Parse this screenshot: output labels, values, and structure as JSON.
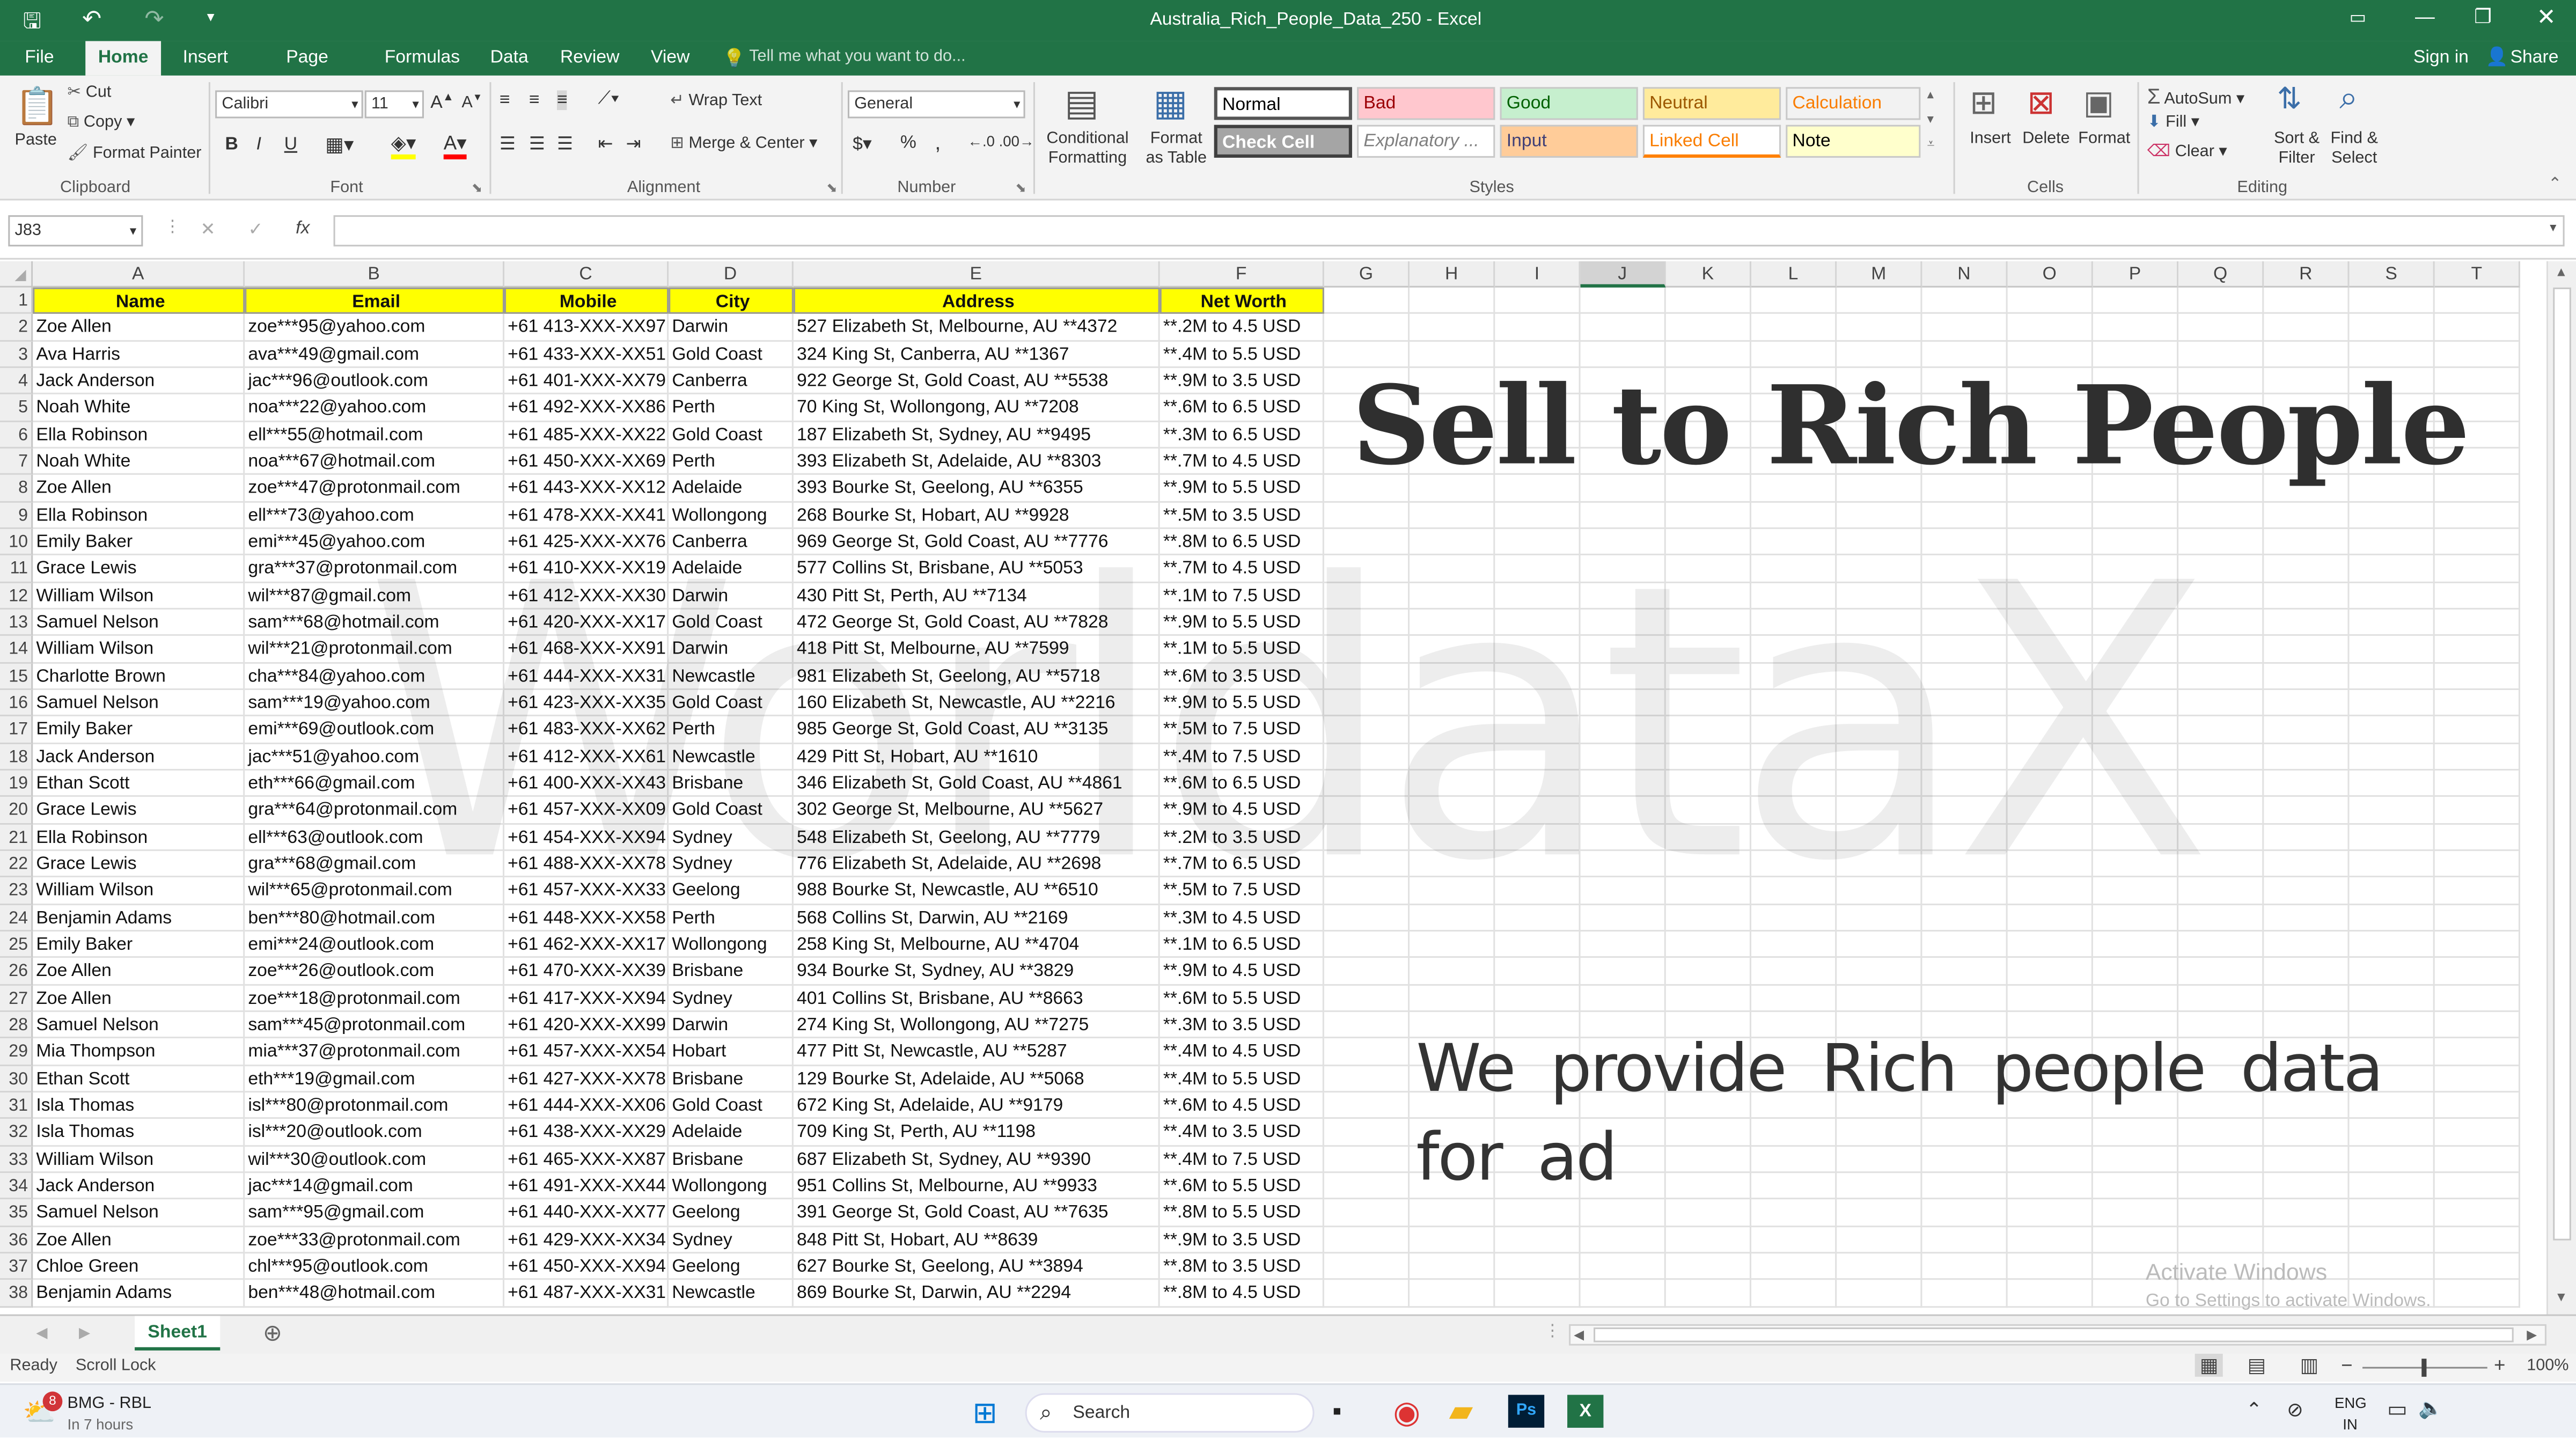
{
  "window": {
    "title": "Australia_Rich_People_Data_250 - Excel",
    "signin": "Sign in",
    "share": "Share",
    "tell_me": "Tell me what you want to do..."
  },
  "ribbon_tabs": [
    "File",
    "Home",
    "Insert",
    "Page Layout",
    "Formulas",
    "Data",
    "Review",
    "View"
  ],
  "ribbon": {
    "clipboard": {
      "paste": "Paste",
      "cut": "Cut",
      "copy": "Copy",
      "format_painter": "Format Painter",
      "label": "Clipboard"
    },
    "font": {
      "name": "Calibri",
      "size": "11",
      "label": "Font",
      "bold": "B",
      "italic": "I",
      "underline": "U"
    },
    "alignment": {
      "wrap": "Wrap Text",
      "merge": "Merge & Center",
      "label": "Alignment"
    },
    "number": {
      "format": "General",
      "percent": "%",
      "comma": ",",
      "label": "Number"
    },
    "styles": {
      "conditional": "Conditional Formatting",
      "format_table": "Format as Table",
      "label": "Styles",
      "items": [
        {
          "name": "Normal",
          "bg": "#ffffff",
          "fg": "#000000"
        },
        {
          "name": "Bad",
          "bg": "#ffc7ce",
          "fg": "#9c0006"
        },
        {
          "name": "Good",
          "bg": "#c6efce",
          "fg": "#006100"
        },
        {
          "name": "Neutral",
          "bg": "#ffeb9c",
          "fg": "#9c5700"
        },
        {
          "name": "Calculation",
          "bg": "#f2f2f2",
          "fg": "#fa7d00"
        },
        {
          "name": "Check Cell",
          "bg": "#a5a5a5",
          "fg": "#ffffff"
        },
        {
          "name": "Explanatory ...",
          "bg": "#ffffff",
          "fg": "#7f7f7f"
        },
        {
          "name": "Input",
          "bg": "#ffcc99",
          "fg": "#3f3f76"
        },
        {
          "name": "Linked Cell",
          "bg": "#ffffff",
          "fg": "#fa7d00"
        },
        {
          "name": "Note",
          "bg": "#ffffcc",
          "fg": "#000000"
        }
      ]
    },
    "cells": {
      "insert": "Insert",
      "delete": "Delete",
      "format": "Format",
      "label": "Cells"
    },
    "editing": {
      "autosum": "AutoSum",
      "fill": "Fill",
      "clear": "Clear",
      "sort": "Sort & Filter",
      "find": "Find & Select",
      "label": "Editing"
    }
  },
  "formula_bar": {
    "name_box": "J83",
    "fx": "fx",
    "cancel": "✕",
    "enter": "✓",
    "value": ""
  },
  "columns": [
    "A",
    "B",
    "C",
    "D",
    "E",
    "F",
    "G",
    "H",
    "I",
    "J",
    "K",
    "L",
    "M",
    "N",
    "O",
    "P",
    "Q",
    "R",
    "S",
    "T"
  ],
  "headers": [
    "Name",
    "Email",
    "Mobile",
    "City",
    "Address",
    "Net Worth"
  ],
  "rows": [
    [
      "Zoe Allen",
      "zoe***95@yahoo.com",
      "+61 413-XXX-XX97",
      "Darwin",
      "527 Elizabeth St, Melbourne, AU **4372",
      "**.2M to 4.5 USD"
    ],
    [
      "Ava Harris",
      "ava***49@gmail.com",
      "+61 433-XXX-XX51",
      "Gold Coast",
      "324 King St, Canberra, AU **1367",
      "**.4M to 5.5 USD"
    ],
    [
      "Jack Anderson",
      "jac***96@outlook.com",
      "+61 401-XXX-XX79",
      "Canberra",
      "922 George St, Gold Coast, AU **5538",
      "**.9M to 3.5 USD"
    ],
    [
      "Noah White",
      "noa***22@yahoo.com",
      "+61 492-XXX-XX86",
      "Perth",
      "70 King St, Wollongong, AU **7208",
      "**.6M to 6.5 USD"
    ],
    [
      "Ella Robinson",
      "ell***55@hotmail.com",
      "+61 485-XXX-XX22",
      "Gold Coast",
      "187 Elizabeth St, Sydney, AU **9495",
      "**.3M to 6.5 USD"
    ],
    [
      "Noah White",
      "noa***67@hotmail.com",
      "+61 450-XXX-XX69",
      "Perth",
      "393 Elizabeth St, Adelaide, AU **8303",
      "**.7M to 4.5 USD"
    ],
    [
      "Zoe Allen",
      "zoe***47@protonmail.com",
      "+61 443-XXX-XX12",
      "Adelaide",
      "393 Bourke St, Geelong, AU **6355",
      "**.9M to 5.5 USD"
    ],
    [
      "Ella Robinson",
      "ell***73@yahoo.com",
      "+61 478-XXX-XX41",
      "Wollongong",
      "268 Bourke St, Hobart, AU **9928",
      "**.5M to 3.5 USD"
    ],
    [
      "Emily Baker",
      "emi***45@yahoo.com",
      "+61 425-XXX-XX76",
      "Canberra",
      "969 George St, Gold Coast, AU **7776",
      "**.8M to 6.5 USD"
    ],
    [
      "Grace Lewis",
      "gra***37@protonmail.com",
      "+61 410-XXX-XX19",
      "Adelaide",
      "577 Collins St, Brisbane, AU **5053",
      "**.7M to 4.5 USD"
    ],
    [
      "William Wilson",
      "wil***87@gmail.com",
      "+61 412-XXX-XX30",
      "Darwin",
      "430 Pitt St, Perth, AU **7134",
      "**.1M to 7.5 USD"
    ],
    [
      "Samuel Nelson",
      "sam***68@hotmail.com",
      "+61 420-XXX-XX17",
      "Gold Coast",
      "472 George St, Gold Coast, AU **7828",
      "**.9M to 5.5 USD"
    ],
    [
      "William Wilson",
      "wil***21@protonmail.com",
      "+61 468-XXX-XX91",
      "Darwin",
      "418 Pitt St, Melbourne, AU **7599",
      "**.1M to 5.5 USD"
    ],
    [
      "Charlotte Brown",
      "cha***84@yahoo.com",
      "+61 444-XXX-XX31",
      "Newcastle",
      "981 Elizabeth St, Geelong, AU **5718",
      "**.6M to 3.5 USD"
    ],
    [
      "Samuel Nelson",
      "sam***19@yahoo.com",
      "+61 423-XXX-XX35",
      "Gold Coast",
      "160 Elizabeth St, Newcastle, AU **2216",
      "**.9M to 5.5 USD"
    ],
    [
      "Emily Baker",
      "emi***69@outlook.com",
      "+61 483-XXX-XX62",
      "Perth",
      "985 George St, Gold Coast, AU **3135",
      "**.5M to 7.5 USD"
    ],
    [
      "Jack Anderson",
      "jac***51@yahoo.com",
      "+61 412-XXX-XX61",
      "Newcastle",
      "429 Pitt St, Hobart, AU **1610",
      "**.4M to 7.5 USD"
    ],
    [
      "Ethan Scott",
      "eth***66@gmail.com",
      "+61 400-XXX-XX43",
      "Brisbane",
      "346 Elizabeth St, Gold Coast, AU **4861",
      "**.6M to 6.5 USD"
    ],
    [
      "Grace Lewis",
      "gra***64@protonmail.com",
      "+61 457-XXX-XX09",
      "Gold Coast",
      "302 George St, Melbourne, AU **5627",
      "**.9M to 4.5 USD"
    ],
    [
      "Ella Robinson",
      "ell***63@outlook.com",
      "+61 454-XXX-XX94",
      "Sydney",
      "548 Elizabeth St, Geelong, AU **7779",
      "**.2M to 3.5 USD"
    ],
    [
      "Grace Lewis",
      "gra***68@gmail.com",
      "+61 488-XXX-XX78",
      "Sydney",
      "776 Elizabeth St, Adelaide, AU **2698",
      "**.7M to 6.5 USD"
    ],
    [
      "William Wilson",
      "wil***65@protonmail.com",
      "+61 457-XXX-XX33",
      "Geelong",
      "988 Bourke St, Newcastle, AU **6510",
      "**.5M to 7.5 USD"
    ],
    [
      "Benjamin Adams",
      "ben***80@hotmail.com",
      "+61 448-XXX-XX58",
      "Perth",
      "568 Collins St, Darwin, AU **2169",
      "**.3M to 4.5 USD"
    ],
    [
      "Emily Baker",
      "emi***24@outlook.com",
      "+61 462-XXX-XX17",
      "Wollongong",
      "258 King St, Melbourne, AU **4704",
      "**.1M to 6.5 USD"
    ],
    [
      "Zoe Allen",
      "zoe***26@outlook.com",
      "+61 470-XXX-XX39",
      "Brisbane",
      "934 Bourke St, Sydney, AU **3829",
      "**.9M to 4.5 USD"
    ],
    [
      "Zoe Allen",
      "zoe***18@protonmail.com",
      "+61 417-XXX-XX94",
      "Sydney",
      "401 Collins St, Brisbane, AU **8663",
      "**.6M to 5.5 USD"
    ],
    [
      "Samuel Nelson",
      "sam***45@protonmail.com",
      "+61 420-XXX-XX99",
      "Darwin",
      "274 King St, Wollongong, AU **7275",
      "**.3M to 3.5 USD"
    ],
    [
      "Mia Thompson",
      "mia***37@protonmail.com",
      "+61 457-XXX-XX54",
      "Hobart",
      "477 Pitt St, Newcastle, AU **5287",
      "**.4M to 4.5 USD"
    ],
    [
      "Ethan Scott",
      "eth***19@gmail.com",
      "+61 427-XXX-XX78",
      "Brisbane",
      "129 Bourke St, Adelaide, AU **5068",
      "**.4M to 5.5 USD"
    ],
    [
      "Isla Thomas",
      "isl***80@protonmail.com",
      "+61 444-XXX-XX06",
      "Gold Coast",
      "672 King St, Adelaide, AU **9179",
      "**.6M to 4.5 USD"
    ],
    [
      "Isla Thomas",
      "isl***20@outlook.com",
      "+61 438-XXX-XX29",
      "Adelaide",
      "709 King St, Perth, AU **1198",
      "**.4M to 3.5 USD"
    ],
    [
      "William Wilson",
      "wil***30@outlook.com",
      "+61 465-XXX-XX87",
      "Brisbane",
      "687 Elizabeth St, Sydney, AU **9390",
      "**.4M to 7.5 USD"
    ],
    [
      "Jack Anderson",
      "jac***14@gmail.com",
      "+61 491-XXX-XX44",
      "Wollongong",
      "951 Collins St, Melbourne, AU **9933",
      "**.6M to 5.5 USD"
    ],
    [
      "Samuel Nelson",
      "sam***95@gmail.com",
      "+61 440-XXX-XX77",
      "Geelong",
      "391 George St, Gold Coast, AU **7635",
      "**.8M to 5.5 USD"
    ],
    [
      "Zoe Allen",
      "zoe***33@protonmail.com",
      "+61 429-XXX-XX34",
      "Sydney",
      "848 Pitt St, Hobart, AU **8639",
      "**.9M to 3.5 USD"
    ],
    [
      "Chloe Green",
      "chl***95@outlook.com",
      "+61 450-XXX-XX94",
      "Geelong",
      "627 Bourke St, Geelong, AU **3894",
      "**.8M to 3.5 USD"
    ],
    [
      "Benjamin Adams",
      "ben***48@hotmail.com",
      "+61 487-XXX-XX31",
      "Newcastle",
      "869 Bourke St, Darwin, AU **2294",
      "**.8M to 4.5 USD"
    ]
  ],
  "overlay": {
    "headline": "Sell to Rich People",
    "watermark": "WorldataX",
    "tagline_line1": "We provide Rich people data",
    "tagline_line2": "for ad"
  },
  "activate": {
    "line1": "Activate Windows",
    "line2": "Go to Settings to activate Windows."
  },
  "sheet": {
    "tab": "Sheet1"
  },
  "status": {
    "ready": "Ready",
    "scroll_lock": "Scroll Lock",
    "zoom": "100%"
  },
  "taskbar": {
    "news_title": "BMG - RBL",
    "news_sub": "In 7 hours",
    "news_badge": "8",
    "search": "Search",
    "lang1": "ENG",
    "lang2": "IN"
  },
  "colors": {
    "excel_green": "#217346",
    "header_yellow": "#ffff00"
  }
}
